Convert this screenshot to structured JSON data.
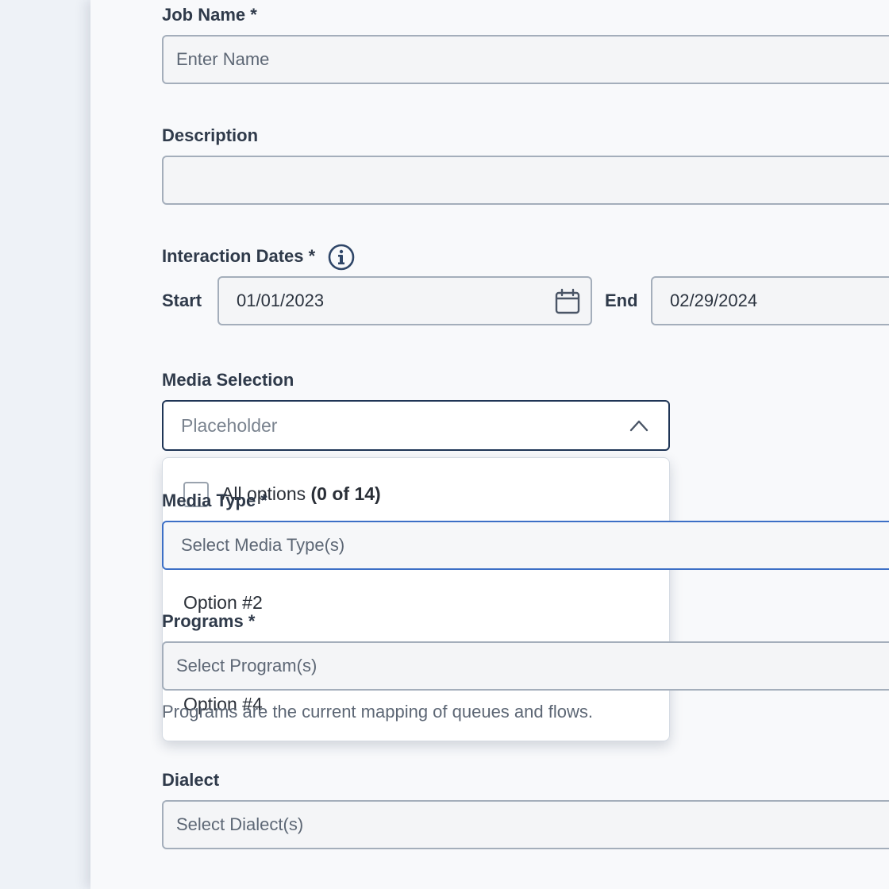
{
  "form": {
    "job_name": {
      "label": "Job Name *",
      "placeholder": "Enter Name"
    },
    "description": {
      "label": "Description",
      "value": ""
    },
    "interaction_dates": {
      "label": "Interaction Dates *",
      "start_label": "Start",
      "start_value": "01/01/2023",
      "end_label": "End",
      "end_value": "02/29/2024"
    },
    "media_selection": {
      "label": "Media Selection",
      "placeholder": "Placeholder",
      "expanded": true,
      "menu": {
        "all_options_label": "All options",
        "all_options_count": "(0 of 14)",
        "options": [
          "Option #2",
          "Option #4"
        ]
      }
    },
    "media_type": {
      "label": "Media Type *",
      "placeholder": "Select Media Type(s)"
    },
    "programs": {
      "label": "Programs *",
      "placeholder": "Select Program(s)",
      "helper": "Programs are the current mapping of queues and flows."
    },
    "dialect": {
      "label": "Dialect",
      "placeholder": "Select Dialect(s)"
    }
  },
  "icons": {
    "info": "info-icon",
    "calendar": "calendar-icon",
    "chevron": "chevron-up-icon"
  },
  "colors": {
    "focus_border": "#1f3556",
    "active_border": "#3c6fc6",
    "field_border": "#a4aebb"
  }
}
